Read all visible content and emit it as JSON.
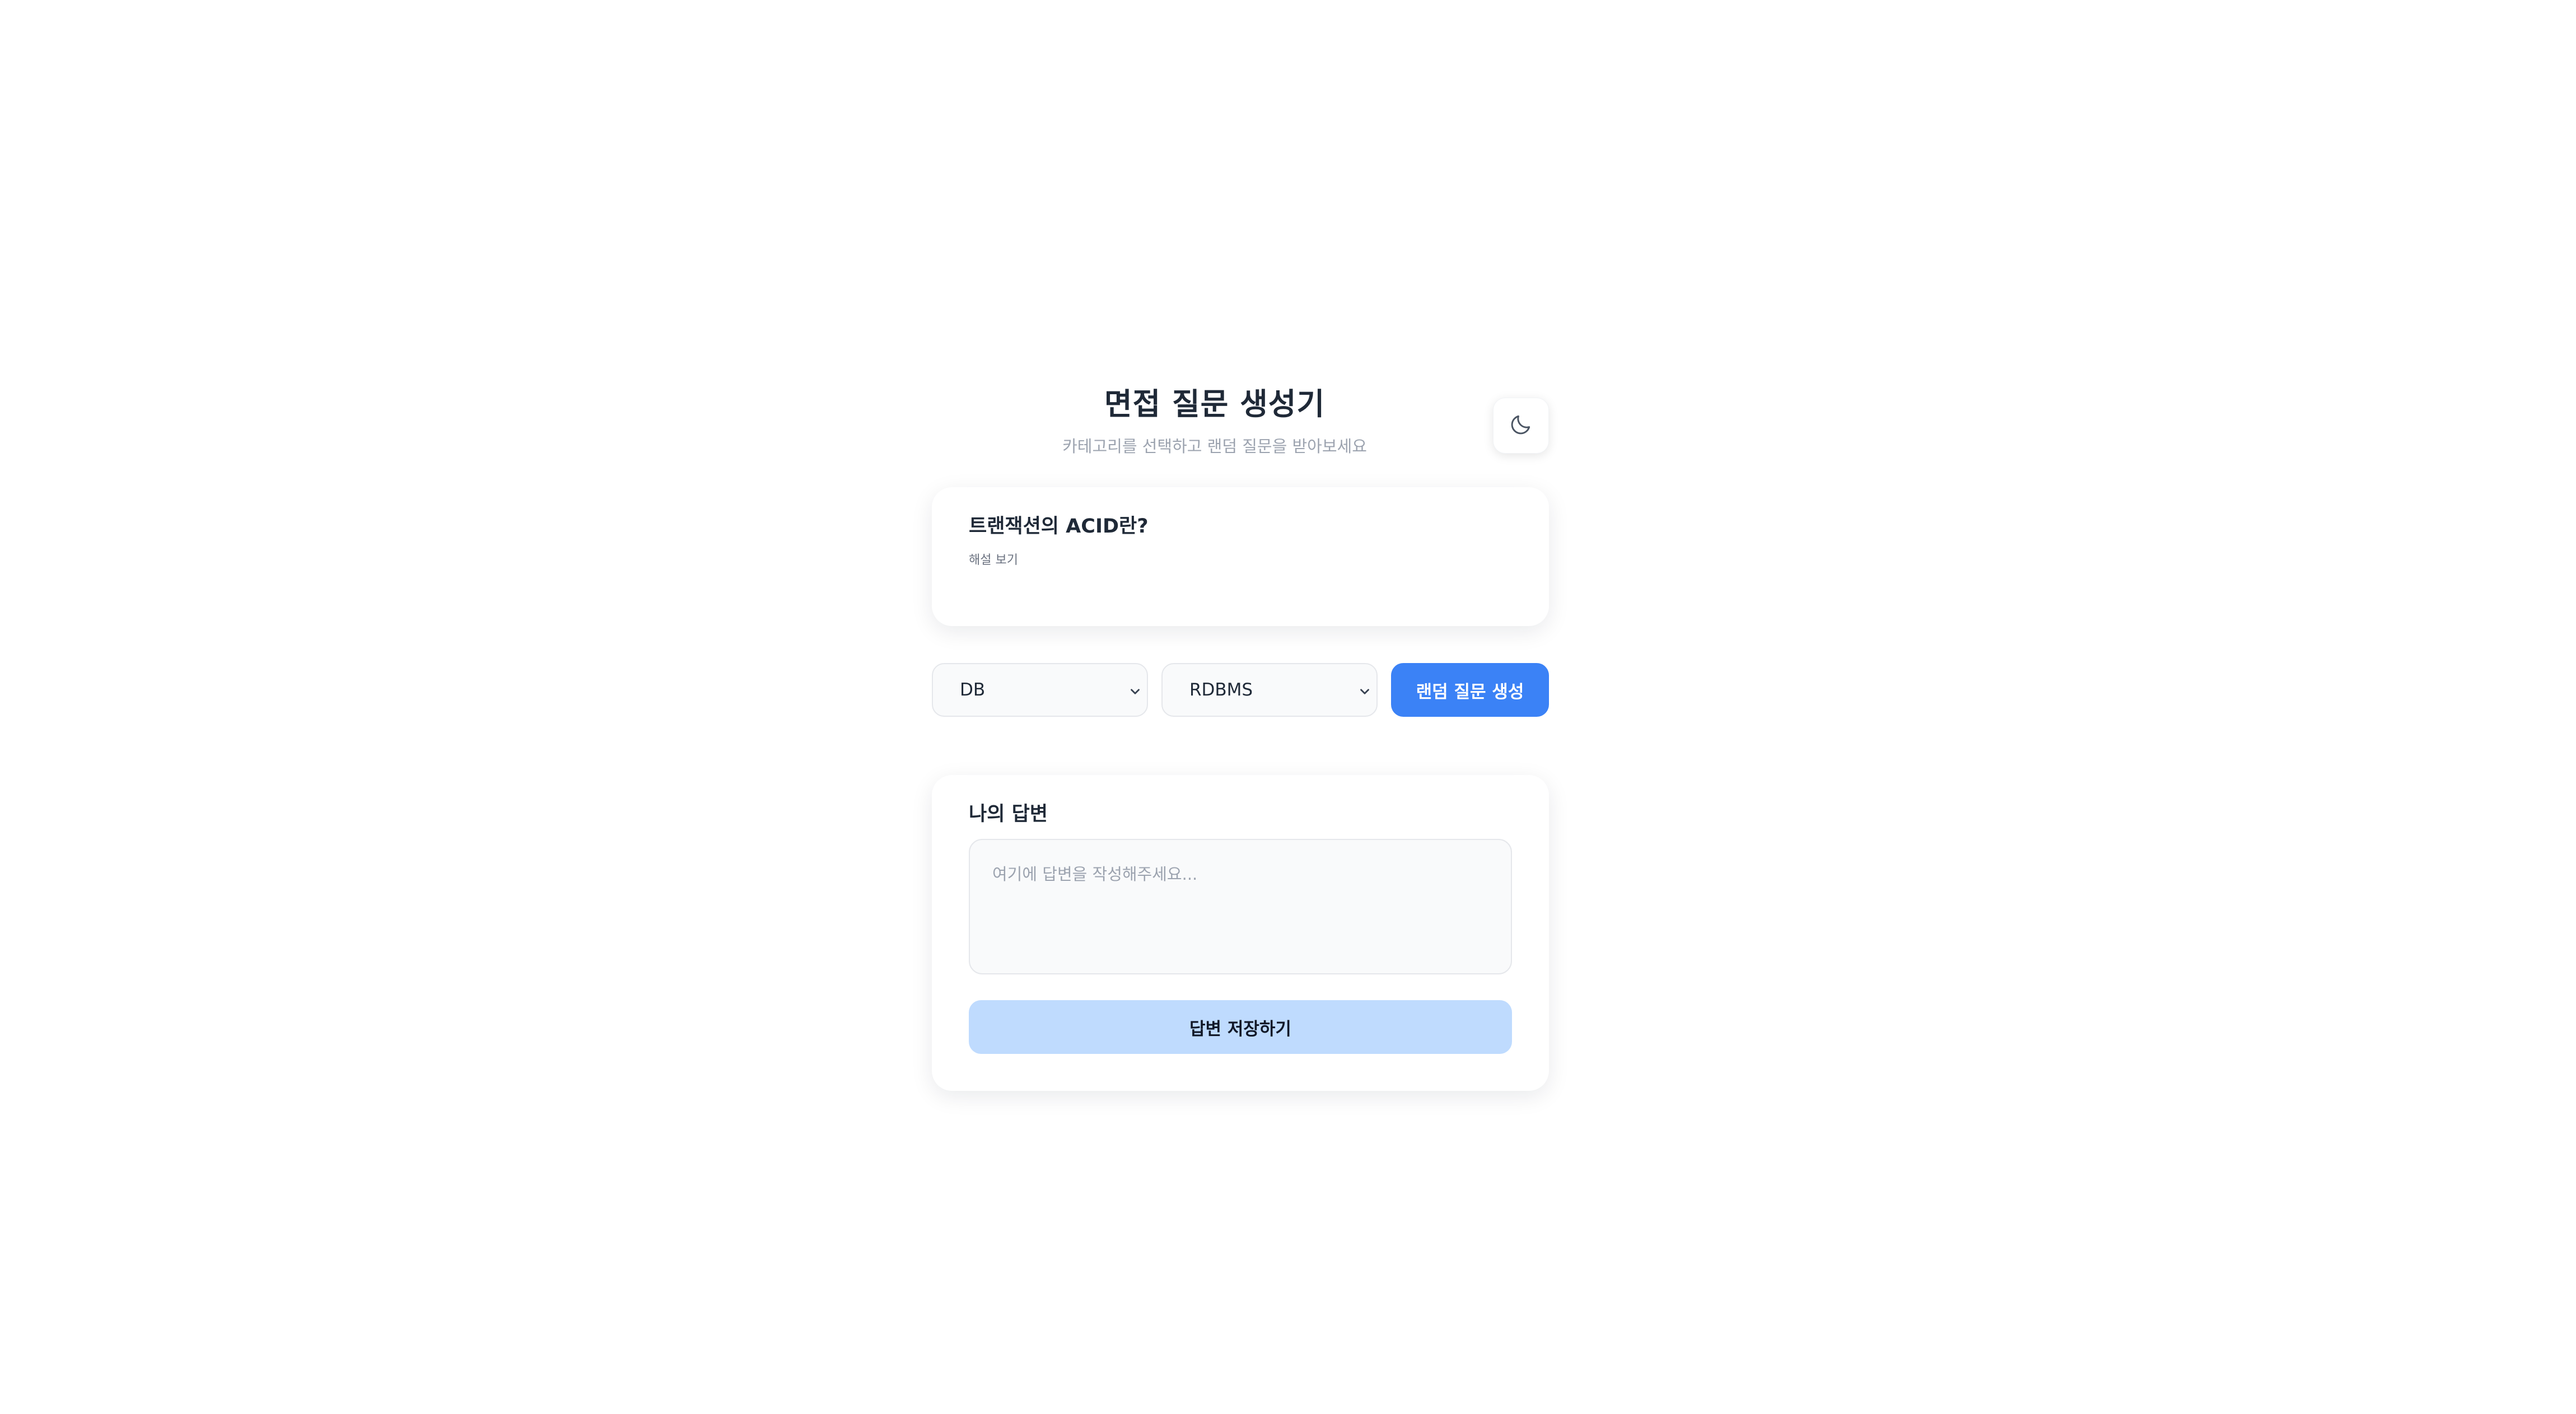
{
  "header": {
    "title": "면접 질문 생성기",
    "subtitle": "카테고리를 선택하고 랜덤 질문을 받아보세요",
    "theme_toggle_icon": "moon-icon"
  },
  "question": {
    "text": "트랜잭션의 ACID란?",
    "explain_label": "해설 보기"
  },
  "controls": {
    "category_select": {
      "selected": "DB",
      "icon": "chevron-down-icon"
    },
    "subcategory_select": {
      "selected": "RDBMS",
      "icon": "chevron-down-icon"
    },
    "generate_label": "랜덤 질문 생성"
  },
  "answer": {
    "label": "나의 답변",
    "placeholder": "여기에 답변을 작성해주세요...",
    "save_label": "답변 저장하기"
  },
  "colors": {
    "primary": "#3b82f6",
    "primary_light": "#bfdbfe",
    "text_dark": "#1f2937",
    "text_muted": "#9ca3af"
  }
}
